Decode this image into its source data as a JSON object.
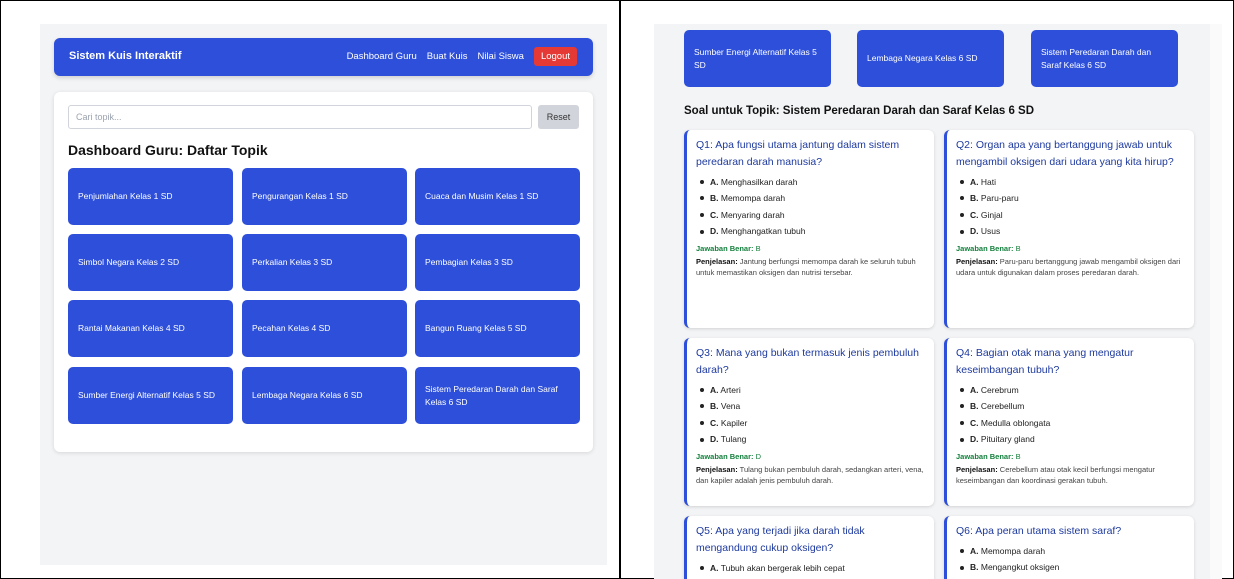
{
  "left": {
    "nav": {
      "brand": "Sistem Kuis Interaktif",
      "links": [
        "Dashboard Guru",
        "Buat Kuis",
        "Nilai Siswa"
      ],
      "logout": "Logout"
    },
    "search": {
      "placeholder": "Cari topik...",
      "reset": "Reset"
    },
    "heading": "Dashboard Guru: Daftar Topik",
    "topics": [
      "Penjumlahan Kelas 1 SD",
      "Pengurangan Kelas 1 SD",
      "Cuaca dan Musim Kelas 1 SD",
      "Simbol Negara Kelas 2 SD",
      "Perkalian Kelas 3 SD",
      "Pembagian Kelas 3 SD",
      "Rantai Makanan Kelas 4 SD",
      "Pecahan Kelas 4 SD",
      "Bangun Ruang Kelas 5 SD",
      "Sumber Energi Alternatif Kelas 5 SD",
      "Lembaga Negara Kelas 6 SD",
      "Sistem Peredaran Darah dan Saraf Kelas 6 SD"
    ]
  },
  "right": {
    "topics": [
      "Sumber Energi Alternatif Kelas 5 SD",
      "Lembaga Negara Kelas 6 SD",
      "Sistem Peredaran Darah dan Saraf Kelas 6 SD"
    ],
    "heading": "Soal untuk Topik: Sistem Peredaran Darah dan Saraf Kelas 6 SD",
    "answer_label": "Jawaban Benar:",
    "explanation_label": "Penjelasan:",
    "questions": [
      {
        "q": "Q1: Apa fungsi utama jantung dalam sistem peredaran darah manusia?",
        "options": [
          [
            "A.",
            "Menghasilkan darah"
          ],
          [
            "B.",
            "Memompa darah"
          ],
          [
            "C.",
            "Menyaring darah"
          ],
          [
            "D.",
            "Menghangatkan tubuh"
          ]
        ],
        "answer": "B",
        "explanation": "Jantung berfungsi memompa darah ke seluruh tubuh untuk memastikan oksigen dan nutrisi tersebar."
      },
      {
        "q": "Q2: Organ apa yang bertanggung jawab untuk mengambil oksigen dari udara yang kita hirup?",
        "options": [
          [
            "A.",
            "Hati"
          ],
          [
            "B.",
            "Paru-paru"
          ],
          [
            "C.",
            "Ginjal"
          ],
          [
            "D.",
            "Usus"
          ]
        ],
        "answer": "B",
        "explanation": "Paru-paru bertanggung jawab mengambil oksigen dari udara untuk digunakan dalam proses peredaran darah."
      },
      {
        "q": "Q3: Mana yang bukan termasuk jenis pembuluh darah?",
        "options": [
          [
            "A.",
            "Arteri"
          ],
          [
            "B.",
            "Vena"
          ],
          [
            "C.",
            "Kapiler"
          ],
          [
            "D.",
            "Tulang"
          ]
        ],
        "answer": "D",
        "explanation": "Tulang bukan pembuluh darah, sedangkan arteri, vena, dan kapiler adalah jenis pembuluh darah."
      },
      {
        "q": "Q4: Bagian otak mana yang mengatur keseimbangan tubuh?",
        "options": [
          [
            "A.",
            "Cerebrum"
          ],
          [
            "B.",
            "Cerebellum"
          ],
          [
            "C.",
            "Medulla oblongata"
          ],
          [
            "D.",
            "Pituitary gland"
          ]
        ],
        "answer": "B",
        "explanation": "Cerebellum atau otak kecil berfungsi mengatur keseimbangan dan koordinasi gerakan tubuh."
      },
      {
        "q": "Q5: Apa yang terjadi jika darah tidak mengandung cukup oksigen?",
        "options": [
          [
            "A.",
            "Tubuh akan bergerak lebih cepat"
          ]
        ],
        "answer": "",
        "explanation": ""
      },
      {
        "q": "Q6: Apa peran utama sistem saraf?",
        "options": [
          [
            "A.",
            "Memompa darah"
          ],
          [
            "B.",
            "Mengangkut oksigen"
          ]
        ],
        "answer": "",
        "explanation": ""
      }
    ]
  }
}
